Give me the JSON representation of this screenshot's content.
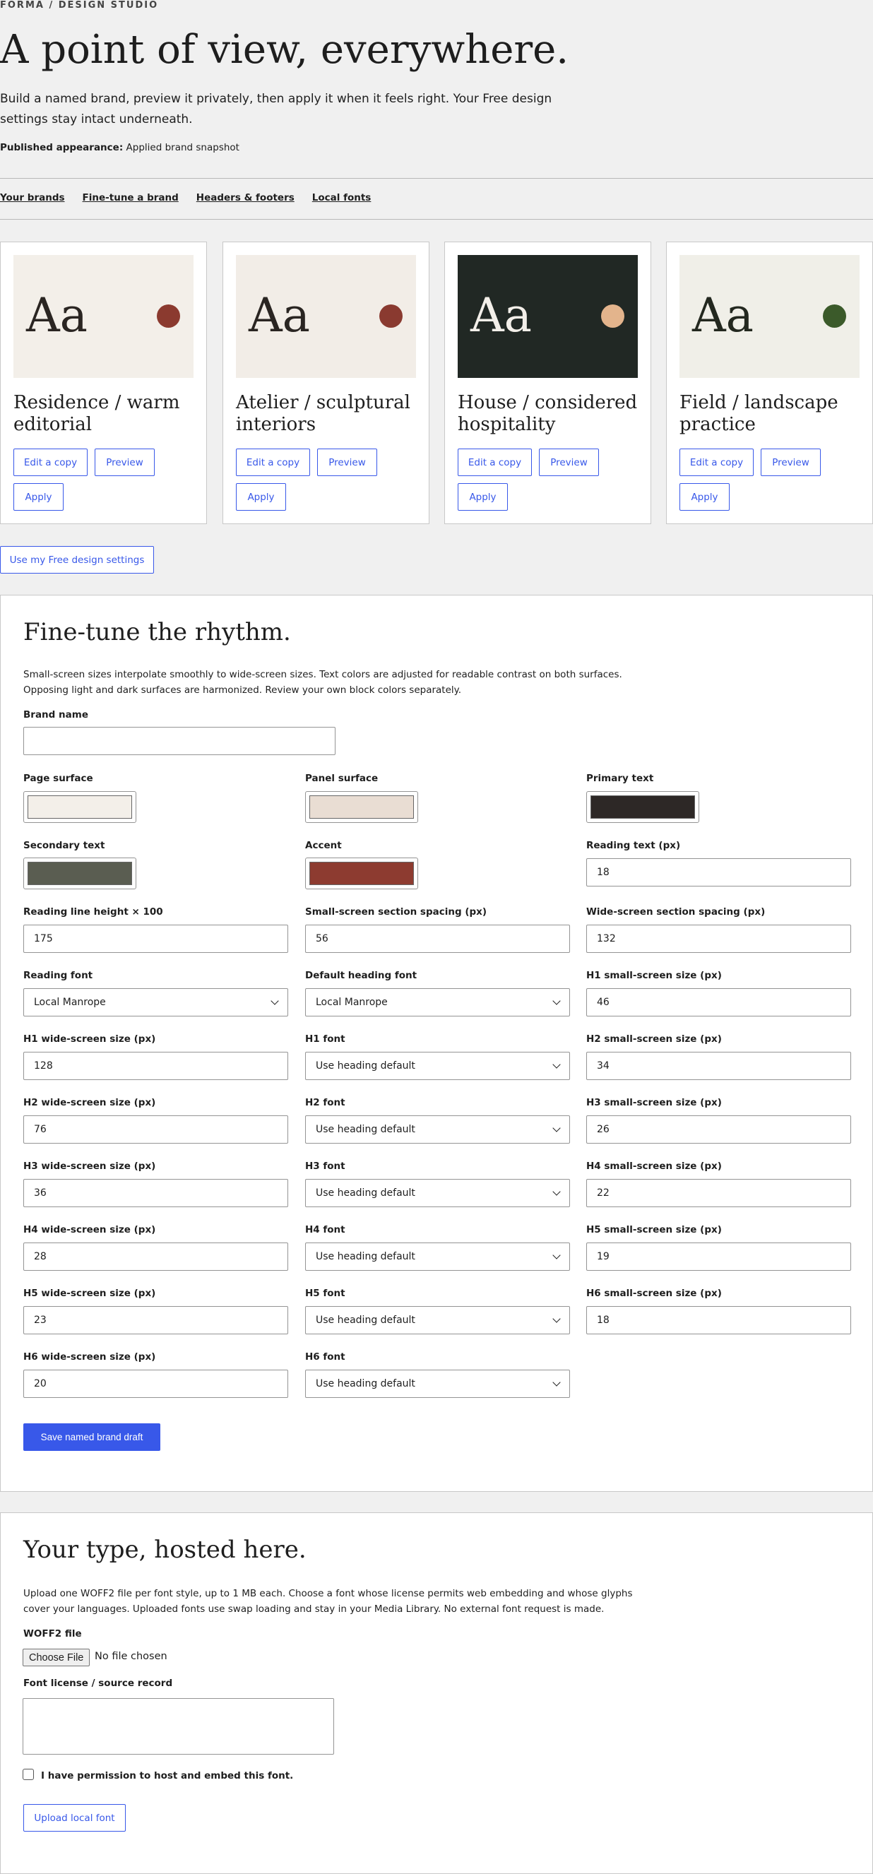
{
  "header": {
    "eyebrow": "FORMA / DESIGN STUDIO",
    "title": "A point of view, everywhere.",
    "description": "Build a named brand, preview it privately, then apply it when it feels right. Your Free design settings stay intact underneath.",
    "published_label": "Published appearance:",
    "published_value": "Applied brand snapshot"
  },
  "nav": {
    "items": [
      "Your brands",
      "Fine-tune a brand",
      "Headers & footers",
      "Local fonts"
    ]
  },
  "brands": [
    {
      "name": "Residence / warm editorial",
      "sample": "Aa",
      "bg": "#f3efe9",
      "fg": "#2a2522",
      "accent": "#8b3a2f"
    },
    {
      "name": "Atelier / sculptural interiors",
      "sample": "Aa",
      "bg": "#f2ede7",
      "fg": "#2a2522",
      "accent": "#8a3a30"
    },
    {
      "name": "House / considered hospitality",
      "sample": "Aa",
      "bg": "#212824",
      "fg": "#f3efe9",
      "accent": "#e3b48c"
    },
    {
      "name": "Field / landscape practice",
      "sample": "Aa",
      "bg": "#f0efe8",
      "fg": "#23281f",
      "accent": "#3b5a2a"
    }
  ],
  "brand_actions": {
    "edit": "Edit a copy",
    "preview": "Preview",
    "apply": "Apply"
  },
  "free_button": "Use my Free design settings",
  "finetune": {
    "title": "Fine-tune the rhythm.",
    "description": "Small-screen sizes interpolate smoothly to wide-screen sizes. Text colors are adjusted for readable contrast on both surfaces. Opposing light and dark surfaces are harmonized. Review your own block colors separately.",
    "brand_name_label": "Brand name",
    "brand_name_value": "",
    "colors": [
      {
        "label": "Page surface",
        "value": "#f3efe9"
      },
      {
        "label": "Panel surface",
        "value": "#e9ddd3"
      },
      {
        "label": "Primary text",
        "value": "#2d2826"
      },
      {
        "label": "Secondary text",
        "value": "#5a5d51"
      },
      {
        "label": "Accent",
        "value": "#8d3b30"
      }
    ],
    "reading_text_label": "Reading text (px)",
    "reading_text_value": "18",
    "line_height_label": "Reading line height × 100",
    "line_height_value": "175",
    "small_spacing_label": "Small-screen section spacing (px)",
    "small_spacing_value": "56",
    "wide_spacing_label": "Wide-screen section spacing (px)",
    "wide_spacing_value": "132",
    "reading_font_label": "Reading font",
    "reading_font_value": "Local Manrope",
    "heading_font_label": "Default heading font",
    "heading_font_value": "Local Manrope",
    "h1_small_label": "H1 small-screen size (px)",
    "h1_small_value": "46",
    "h1_wide_label": "H1 wide-screen size (px)",
    "h1_wide_value": "128",
    "h1_font_label": "H1 font",
    "h1_font_value": "Use heading default",
    "h2_small_label": "H2 small-screen size (px)",
    "h2_small_value": "34",
    "h2_wide_label": "H2 wide-screen size (px)",
    "h2_wide_value": "76",
    "h2_font_label": "H2 font",
    "h2_font_value": "Use heading default",
    "h3_small_label": "H3 small-screen size (px)",
    "h3_small_value": "26",
    "h3_wide_label": "H3 wide-screen size (px)",
    "h3_wide_value": "36",
    "h3_font_label": "H3 font",
    "h3_font_value": "Use heading default",
    "h4_small_label": "H4 small-screen size (px)",
    "h4_small_value": "22",
    "h4_wide_label": "H4 wide-screen size (px)",
    "h4_wide_value": "28",
    "h4_font_label": "H4 font",
    "h4_font_value": "Use heading default",
    "h5_small_label": "H5 small-screen size (px)",
    "h5_small_value": "19",
    "h5_wide_label": "H5 wide-screen size (px)",
    "h5_wide_value": "23",
    "h5_font_label": "H5 font",
    "h5_font_value": "Use heading default",
    "h6_small_label": "H6 small-screen size (px)",
    "h6_small_value": "18",
    "h6_wide_label": "H6 wide-screen size (px)",
    "h6_wide_value": "20",
    "h6_font_label": "H6 font",
    "h6_font_value": "Use heading default",
    "save_button": "Save named brand draft"
  },
  "fonts": {
    "title": "Your type, hosted here.",
    "description": "Upload one WOFF2 file per font style, up to 1 MB each. Choose a font whose license permits web embedding and whose glyphs cover your languages. Uploaded fonts use swap loading and stay in your Media Library. No external font request is made.",
    "file_label": "WOFF2 file",
    "file_button": "Choose File",
    "file_status": "No file chosen",
    "license_label": "Font license / source record",
    "permission_label": "I have permission to host and embed this font.",
    "upload_button": "Upload local font"
  },
  "colors": {
    "accent": "#3858e9"
  }
}
